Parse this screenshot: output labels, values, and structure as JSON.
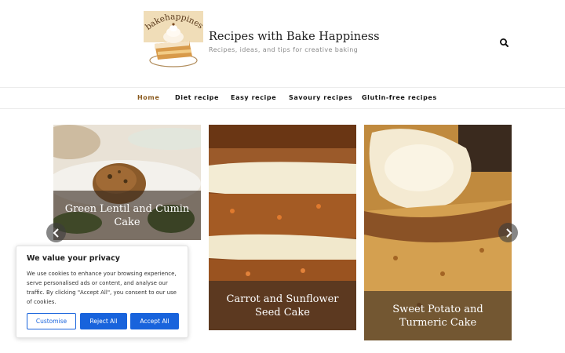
{
  "header": {
    "logo_text": "bakehappiness",
    "title": "Recipes with Bake Happiness",
    "tagline": "Recipes, ideas, and tips for creative baking"
  },
  "nav": {
    "items": [
      {
        "label": "Home",
        "active": true
      },
      {
        "label": "Diet recipe",
        "active": false
      },
      {
        "label": "Easy recipe",
        "active": false
      },
      {
        "label": "Savoury recipes",
        "active": false
      },
      {
        "label": "Glutin-free recipes",
        "active": false
      }
    ]
  },
  "slider": {
    "cards": [
      {
        "title": "Green Lentil and Cumin Cake"
      },
      {
        "title": "Carrot and Sunflower Seed Cake"
      },
      {
        "title": "Sweet Potato and Turmeric Cake"
      }
    ]
  },
  "cookie": {
    "heading": "We value your privacy",
    "body": "We use cookies to enhance your browsing experience, serve personalised ads or content, and analyse our traffic. By clicking \"Accept All\", you consent to our use of cookies.",
    "customise_label": "Customise",
    "reject_label": "Reject All",
    "accept_label": "Accept All"
  },
  "colors": {
    "accent_nav": "#8a5a1e",
    "cookie_button": "#1863dc"
  }
}
